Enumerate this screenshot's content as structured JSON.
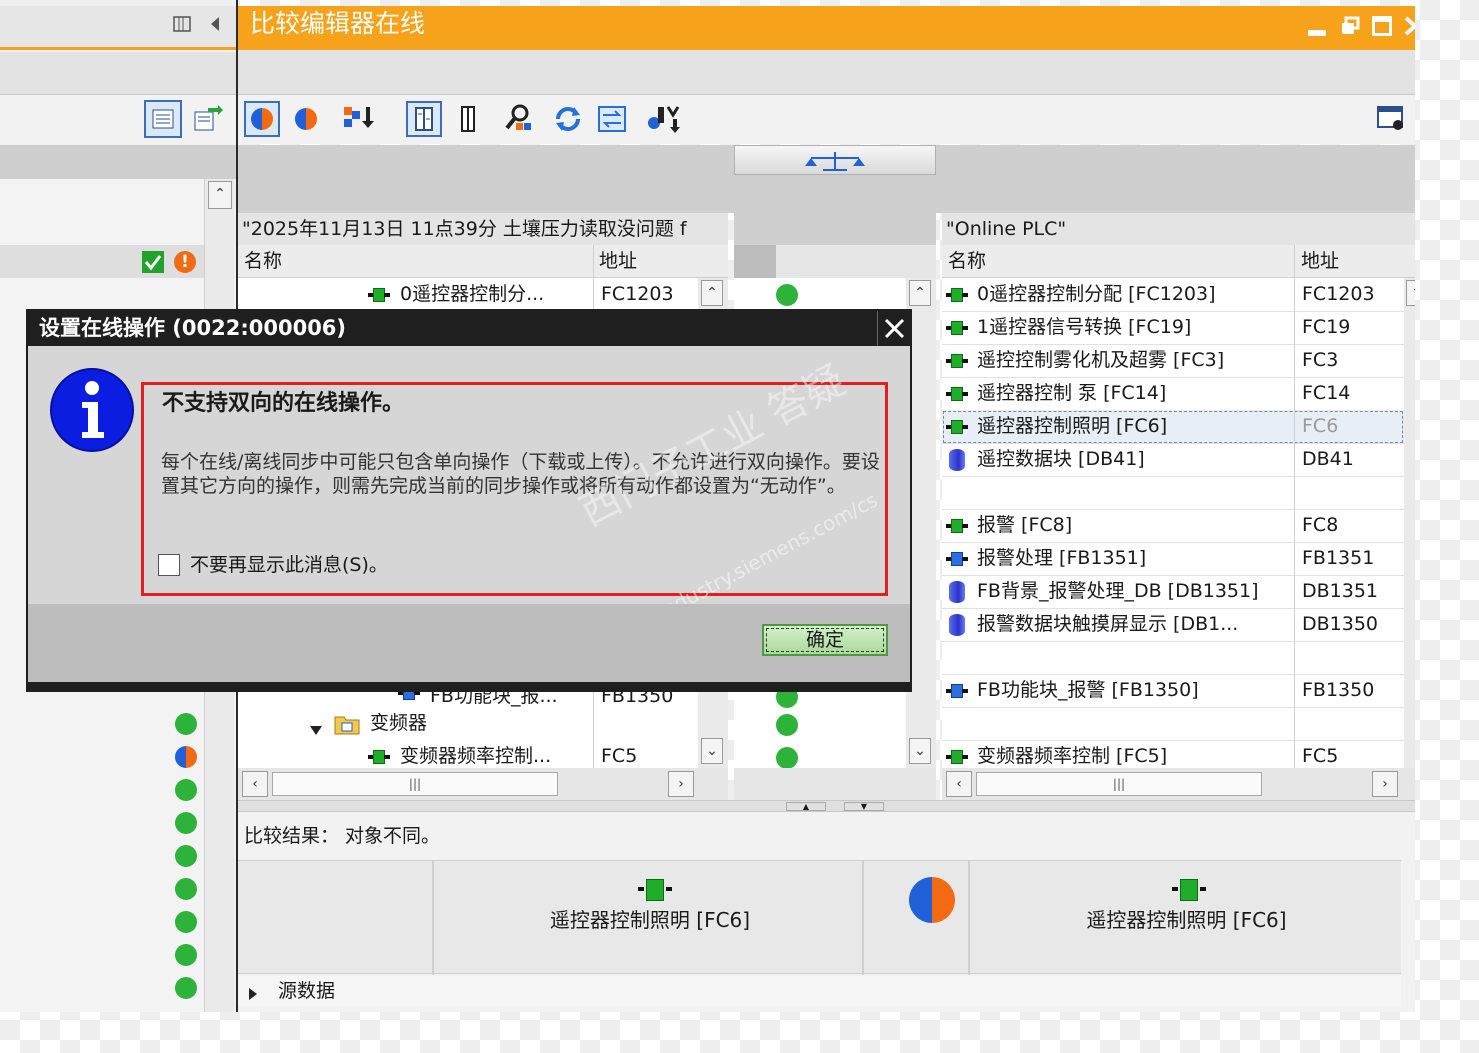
{
  "editor": {
    "title": "比较编辑器在线",
    "left_header": "\"2025年11月13日 11点39分 土壤压力读取没问题 f",
    "right_header": "\"Online PLC\"",
    "col_name": "名称",
    "col_address": "地址"
  },
  "left_rows": [
    {
      "name": "0遥控器控制分...",
      "address": "FC1203"
    },
    {
      "name": "FB功能块_报...",
      "address": "FB1350"
    },
    {
      "name": "变频器",
      "address": ""
    },
    {
      "name": "变频器频率控制...",
      "address": "FC5"
    }
  ],
  "right_rows": [
    {
      "name": "0遥控器控制分配 [FC1203]",
      "address": "FC1203",
      "icon": "fc-block-icon"
    },
    {
      "name": "1遥控器信号转换 [FC19]",
      "address": "FC19",
      "icon": "fc-block-icon"
    },
    {
      "name": "遥控控制雾化机及超雾 [FC3]",
      "address": "FC3",
      "icon": "fc-block-icon"
    },
    {
      "name": "遥控器控制 泵 [FC14]",
      "address": "FC14",
      "icon": "fc-block-icon"
    },
    {
      "name": "遥控器控制照明 [FC6]",
      "address": "FC6",
      "icon": "fc-block-icon"
    },
    {
      "name": "遥控数据块 [DB41]",
      "address": "DB41",
      "icon": "db-block-icon"
    },
    {
      "name": "",
      "address": "",
      "icon": ""
    },
    {
      "name": "报警 [FC8]",
      "address": "FC8",
      "icon": "fc-block-icon"
    },
    {
      "name": "报警处理 [FB1351]",
      "address": "FB1351",
      "icon": "fb-block-icon"
    },
    {
      "name": "FB背景_报警处理_DB [DB1351]",
      "address": "DB1351",
      "icon": "db-block-icon"
    },
    {
      "name": "报警数据块触摸屏显示 [DB1...",
      "address": "DB1350",
      "icon": "db-block-icon"
    },
    {
      "name": "",
      "address": "",
      "icon": ""
    },
    {
      "name": "FB功能块_报警 [FB1350]",
      "address": "FB1350",
      "icon": "fb-block-icon"
    },
    {
      "name": "",
      "address": "",
      "icon": ""
    },
    {
      "name": "变频器频率控制 [FC5]",
      "address": "FC5",
      "icon": "fc-block-icon"
    }
  ],
  "result": {
    "label": "比较结果： 对象不同。",
    "left_object": "遥控器控制照明 [FC6]",
    "right_object": "遥控器控制照明 [FC6]",
    "source_data": "源数据"
  },
  "dialog": {
    "title": "设置在线操作 (0022:000006)",
    "heading": "不支持双向的在线操作。",
    "body": "每个在线/离线同步中可能只包含单向操作（下载或上传）。不允许进行双向操作。要设置其它方向的操作，则需先完成当前的同步操作或将所有动作都设置为“无动作”。",
    "checkbox_label": "不要再显示此消息(S)。",
    "ok_label": "确定",
    "watermark_cn": "西门子工业 答疑",
    "watermark_url": "support.industry.siemens.com/cs"
  },
  "colors": {
    "title_bar": "#f7a21b",
    "dialog_title_bar": "#1f1f1f",
    "highlight_border": "#e02020",
    "status_green": "#2db33a"
  }
}
